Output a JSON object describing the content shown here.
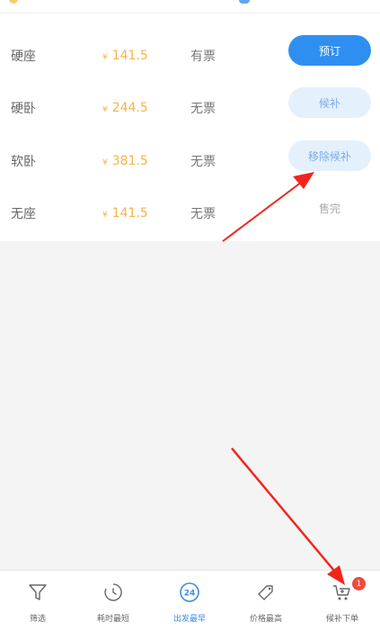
{
  "seats": [
    {
      "type": "硬座",
      "currency": "¥",
      "price": "141.5",
      "availability": "有票",
      "action": "预订",
      "style": "primary"
    },
    {
      "type": "硬卧",
      "currency": "¥",
      "price": "244.5",
      "availability": "无票",
      "action": "候补",
      "style": "light"
    },
    {
      "type": "软卧",
      "currency": "¥",
      "price": "381.5",
      "availability": "无票",
      "action": "移除候补",
      "style": "light"
    },
    {
      "type": "无座",
      "currency": "¥",
      "price": "141.5",
      "availability": "无票",
      "action": "售完",
      "style": "plain"
    }
  ],
  "bottom_bar": {
    "filter": "筛选",
    "duration": "耗时最短",
    "departure": "出发最早",
    "departure_icon_text": "24",
    "price": "价格最高",
    "waitlist": "候补下单",
    "waitlist_badge": "1"
  },
  "colors": {
    "accent": "#2f8ff0",
    "price": "#f7b24a",
    "annotation": "#f2251d",
    "badge": "#f04b3c"
  }
}
